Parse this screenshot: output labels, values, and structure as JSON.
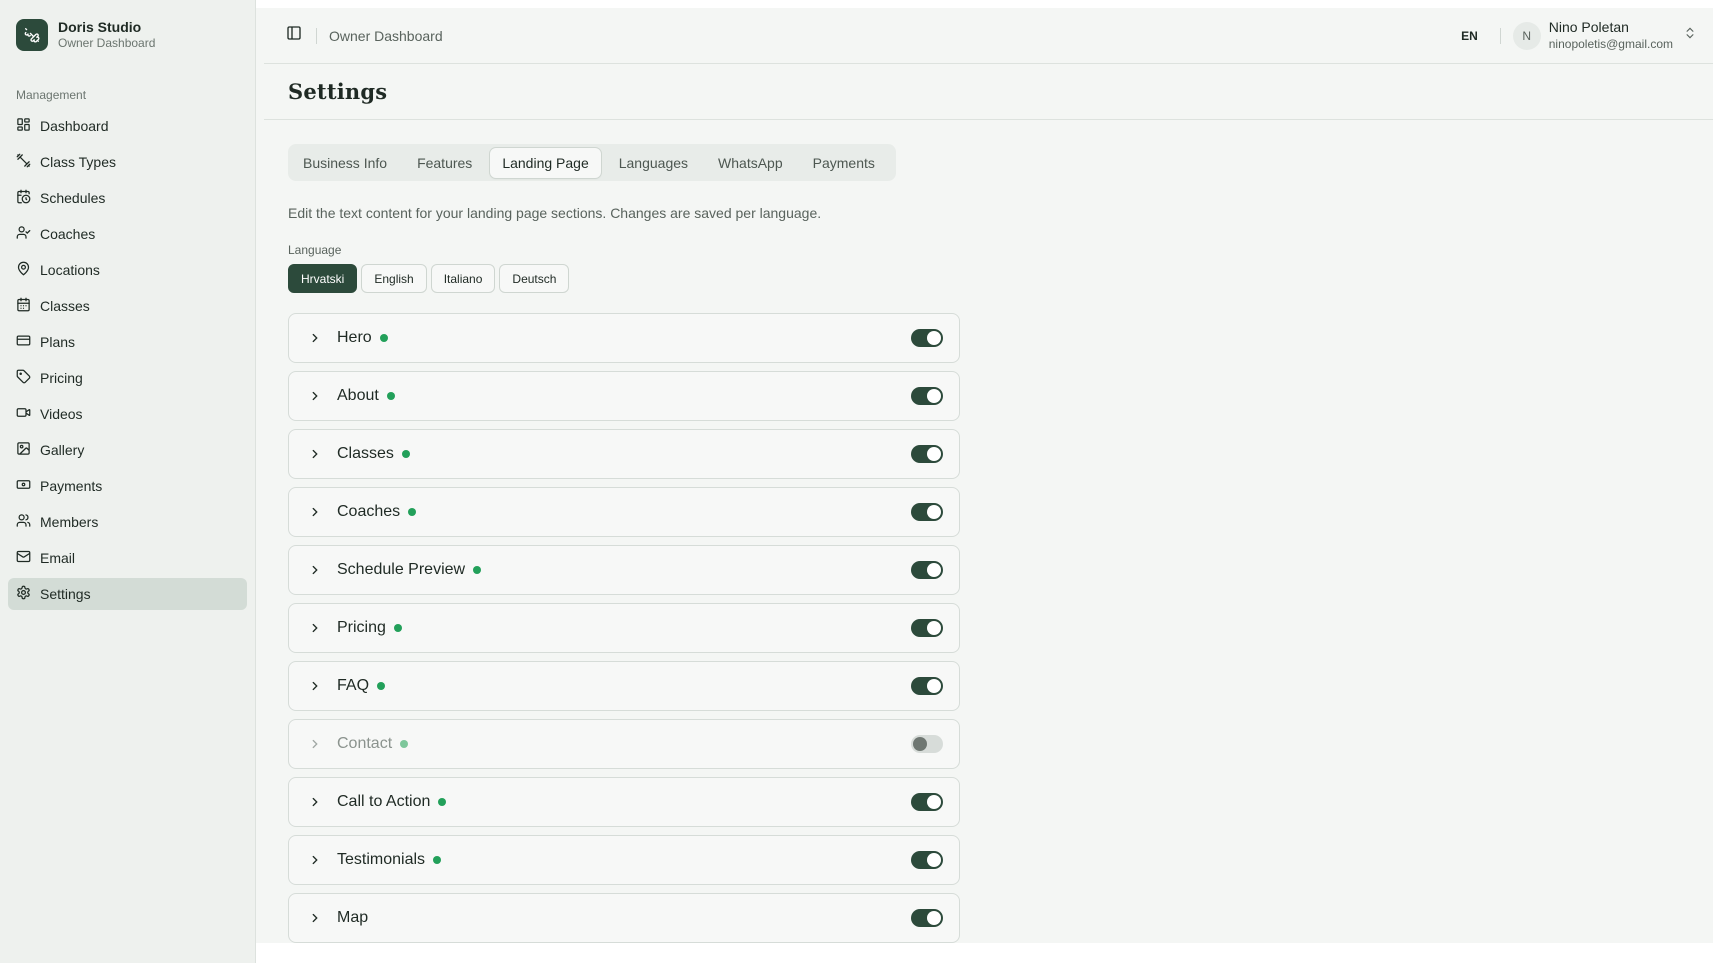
{
  "brand": {
    "name": "Doris Studio",
    "subtitle": "Owner Dashboard",
    "icon": "dumbbell-icon"
  },
  "sidebar": {
    "group_label": "Management",
    "items": [
      {
        "label": "Dashboard",
        "icon": "grid-icon"
      },
      {
        "label": "Class Types",
        "icon": "dumbbell-icon"
      },
      {
        "label": "Schedules",
        "icon": "calendar-clock-icon"
      },
      {
        "label": "Coaches",
        "icon": "user-check-icon"
      },
      {
        "label": "Locations",
        "icon": "map-pin-icon"
      },
      {
        "label": "Classes",
        "icon": "calendar-icon"
      },
      {
        "label": "Plans",
        "icon": "credit-card-icon"
      },
      {
        "label": "Pricing",
        "icon": "tag-icon"
      },
      {
        "label": "Videos",
        "icon": "video-icon"
      },
      {
        "label": "Gallery",
        "icon": "image-icon"
      },
      {
        "label": "Payments",
        "icon": "banknote-icon"
      },
      {
        "label": "Members",
        "icon": "users-icon"
      },
      {
        "label": "Email",
        "icon": "mail-icon"
      },
      {
        "label": "Settings",
        "icon": "gear-icon",
        "active": true
      }
    ]
  },
  "header": {
    "breadcrumb": "Owner Dashboard",
    "language_code": "EN",
    "user": {
      "initial": "N",
      "name": "Nino Poletan",
      "email": "ninopoletis@gmail.com"
    }
  },
  "page": {
    "title": "Settings",
    "tabs": [
      "Business Info",
      "Features",
      "Landing Page",
      "Languages",
      "WhatsApp",
      "Payments"
    ],
    "active_tab": "Landing Page",
    "description": "Edit the text content for your landing page sections. Changes are saved per language.",
    "language_label": "Language",
    "languages": [
      "Hrvatski",
      "English",
      "Italiano",
      "Deutsch"
    ],
    "active_language": "Hrvatski",
    "sections": [
      {
        "name": "Hero",
        "enabled": true
      },
      {
        "name": "About",
        "enabled": true
      },
      {
        "name": "Classes",
        "enabled": true
      },
      {
        "name": "Coaches",
        "enabled": true
      },
      {
        "name": "Schedule Preview",
        "enabled": true
      },
      {
        "name": "Pricing",
        "enabled": true
      },
      {
        "name": "FAQ",
        "enabled": true
      },
      {
        "name": "Contact",
        "enabled": false
      },
      {
        "name": "Call to Action",
        "enabled": true
      },
      {
        "name": "Testimonials",
        "enabled": true
      },
      {
        "name": "Map",
        "enabled": true
      }
    ]
  },
  "colors": {
    "accent": "#2c4a3b",
    "status_dot": "#22a05a",
    "sidebar_active": "#d3dcd6"
  }
}
